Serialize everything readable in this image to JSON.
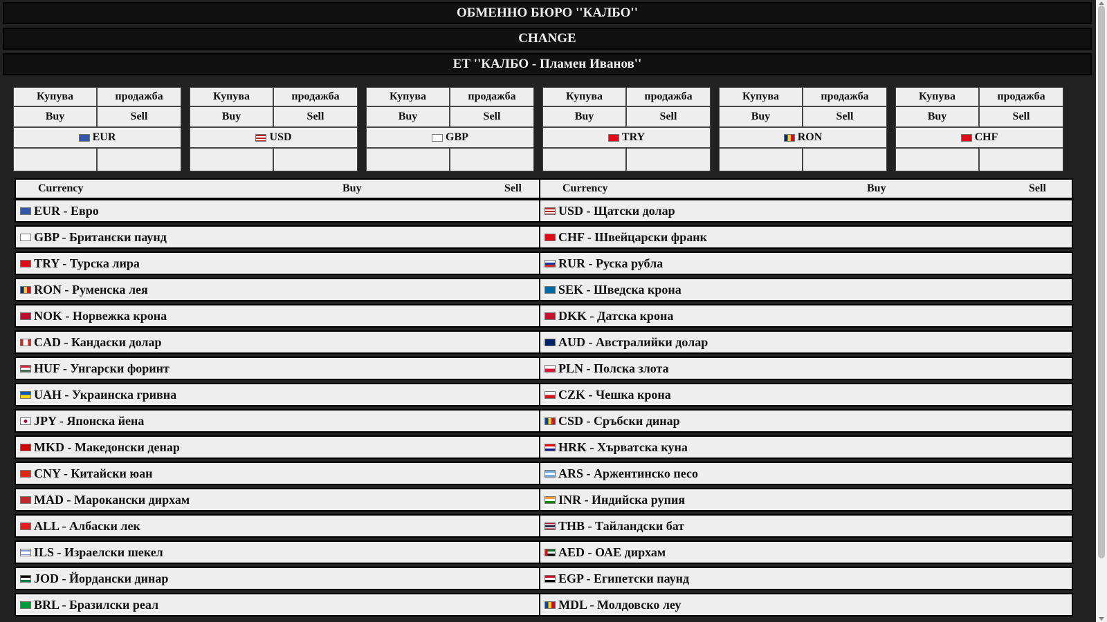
{
  "header": {
    "title": "ОБМЕННО БЮРО ''КАЛБО''",
    "subtitle": "CHANGE",
    "owner": "ЕТ ''КАЛБО - Пламен Иванов''"
  },
  "cards": [
    {
      "buy_bg": "Купува",
      "sell_bg": "продажба",
      "buy_en": "Buy",
      "sell_en": "Sell",
      "code": "EUR",
      "flag": "eu-flag-icon",
      "buy": "",
      "sell": ""
    },
    {
      "buy_bg": "Купува",
      "sell_bg": "продажба",
      "buy_en": "Buy",
      "sell_en": "Sell",
      "code": "USD",
      "flag": "us-flag-icon",
      "buy": "",
      "sell": ""
    },
    {
      "buy_bg": "Купува",
      "sell_bg": "продажба",
      "buy_en": "Buy",
      "sell_en": "Sell",
      "code": "GBP",
      "flag": "gb-flag-icon",
      "buy": "",
      "sell": ""
    },
    {
      "buy_bg": "Купува",
      "sell_bg": "продажба",
      "buy_en": "Buy",
      "sell_en": "Sell",
      "code": "TRY",
      "flag": "tr-flag-icon",
      "buy": "",
      "sell": ""
    },
    {
      "buy_bg": "Купува",
      "sell_bg": "продажба",
      "buy_en": "Buy",
      "sell_en": "Sell",
      "code": "RON",
      "flag": "ro-flag-icon",
      "buy": "",
      "sell": ""
    },
    {
      "buy_bg": "Купува",
      "sell_bg": "продажба",
      "buy_en": "Buy",
      "sell_en": "Sell",
      "code": "CHF",
      "flag": "ch-flag-icon",
      "buy": "",
      "sell": ""
    }
  ],
  "table_headers": {
    "currency": "Currency",
    "buy": "Buy",
    "sell": "Sell"
  },
  "left_rates": [
    {
      "label": "EUR - Евро",
      "flag": "eu-flag-icon"
    },
    {
      "label": "GBP - Британски паунд",
      "flag": "gb-flag-icon"
    },
    {
      "label": "TRY - Турска лира",
      "flag": "tr-flag-icon"
    },
    {
      "label": "RON - Руменска лея",
      "flag": "ro-flag-icon"
    },
    {
      "label": "NOK - Норвежка крона",
      "flag": "no-flag-icon"
    },
    {
      "label": "CAD - Кандаски долар",
      "flag": "ca-flag-icon"
    },
    {
      "label": "HUF - Унгарски форинт",
      "flag": "hu-flag-icon"
    },
    {
      "label": "UAH - Украинска гривна",
      "flag": "ua-flag-icon"
    },
    {
      "label": "JPY - Японска йена",
      "flag": "jp-flag-icon"
    },
    {
      "label": "MKD - Македонски денар",
      "flag": "mk-flag-icon"
    },
    {
      "label": "CNY - Китайски юан",
      "flag": "cn-flag-icon"
    },
    {
      "label": "MAD - Марокански дирхам",
      "flag": "ma-flag-icon"
    },
    {
      "label": "ALL - Албаски лек",
      "flag": "al-flag-icon"
    },
    {
      "label": "ILS - Израелски шекел",
      "flag": "il-flag-icon"
    },
    {
      "label": "JOD - Йордански динар",
      "flag": "jo-flag-icon"
    },
    {
      "label": "BRL - Бразилски реал",
      "flag": "br-flag-icon"
    }
  ],
  "right_rates": [
    {
      "label": "USD - Щатски долар",
      "flag": "us-flag-icon"
    },
    {
      "label": "CHF - Швейцарски франк",
      "flag": "ch-flag-icon"
    },
    {
      "label": "RUR - Руска рубла",
      "flag": "ru-flag-icon"
    },
    {
      "label": "SEK - Шведска крона",
      "flag": "se-flag-icon"
    },
    {
      "label": "DKK - Датска крона",
      "flag": "dk-flag-icon"
    },
    {
      "label": "AUD - Австралийки долар",
      "flag": "au-flag-icon"
    },
    {
      "label": "PLN - Полска злота",
      "flag": "pl-flag-icon"
    },
    {
      "label": "CZK - Чешка крона",
      "flag": "cz-flag-icon"
    },
    {
      "label": "CSD - Сръбски динар",
      "flag": "rs-flag-icon"
    },
    {
      "label": "HRK - Хърватска куна",
      "flag": "hr-flag-icon"
    },
    {
      "label": "ARS - Аржентинско песо",
      "flag": "ar-flag-icon"
    },
    {
      "label": "INR - Индийска рупия",
      "flag": "in-flag-icon"
    },
    {
      "label": "THB - Тайландски бат",
      "flag": "th-flag-icon"
    },
    {
      "label": "AED - ОАЕ дирхам",
      "flag": "ae-flag-icon"
    },
    {
      "label": "EGP - Египетски паунд",
      "flag": "eg-flag-icon"
    },
    {
      "label": "MDL - Молдовско леу",
      "flag": "md-flag-icon"
    }
  ],
  "flag_colors": {
    "eu-flag-icon": "linear-gradient(#3355aa,#3355aa)",
    "us-flag-icon": "repeating-linear-gradient(#b22 0 2px,#fff 2px 4px)",
    "gb-flag-icon": "linear-gradient(#fff,#fff)",
    "tr-flag-icon": "linear-gradient(#e30a17,#e30a17)",
    "ro-flag-icon": "linear-gradient(90deg,#002b7f 33%,#fcd116 33% 66%,#ce1126 66%)",
    "ch-flag-icon": "linear-gradient(#e30a17,#e30a17)",
    "no-flag-icon": "linear-gradient(#ba0c2f,#ba0c2f)",
    "ca-flag-icon": "linear-gradient(90deg,#d52b1e 25%,#fff 25% 75%,#d52b1e 75%)",
    "hu-flag-icon": "linear-gradient(#ce2939 33%,#fff 33% 66%,#477050 66%)",
    "ua-flag-icon": "linear-gradient(#0057b7 50%,#ffd700 50%)",
    "jp-flag-icon": "radial-gradient(circle,#bc002d 28%,#fff 30%)",
    "mk-flag-icon": "linear-gradient(#d20000,#d20000)",
    "cn-flag-icon": "linear-gradient(#de2910,#de2910)",
    "ma-flag-icon": "linear-gradient(#c1272d,#c1272d)",
    "al-flag-icon": "linear-gradient(#e41e20,#e41e20)",
    "il-flag-icon": "linear-gradient(#fff 15%,#0038b8 15% 25%,#fff 25% 75%,#0038b8 75% 85%,#fff 85%)",
    "jo-flag-icon": "linear-gradient(#000 33%,#fff 33% 66%,#007a3d 66%)",
    "br-flag-icon": "linear-gradient(#009c3b,#009c3b)",
    "ru-flag-icon": "linear-gradient(#fff 33%,#0039a6 33% 66%,#d52b1e 66%)",
    "se-flag-icon": "linear-gradient(#006aa7,#006aa7)",
    "dk-flag-icon": "linear-gradient(#c8102e,#c8102e)",
    "au-flag-icon": "linear-gradient(#012169,#012169)",
    "pl-flag-icon": "linear-gradient(#fff 50%,#dc143c 50%)",
    "cz-flag-icon": "linear-gradient(#fff 50%,#d7141a 50%)",
    "rs-flag-icon": "linear-gradient(90deg,#0046ae 33%,#ffd200 33% 66%,#d21034 66%)",
    "hr-flag-icon": "linear-gradient(#ff0000 33%,#fff 33% 66%,#171796 66%)",
    "ar-flag-icon": "linear-gradient(#74acdf 33%,#fff 33% 66%,#74acdf 66%)",
    "in-flag-icon": "linear-gradient(#ff9933 33%,#fff 33% 66%,#138808 66%)",
    "th-flag-icon": "linear-gradient(#a51931 16%,#fff 16% 33%,#2d2a4a 33% 66%,#fff 66% 83%,#a51931 83%)",
    "ae-flag-icon": "linear-gradient(90deg,#ff0000 25%,transparent 25%),linear-gradient(#00732f 33%,#fff 33% 66%,#000 66%)",
    "eg-flag-icon": "linear-gradient(#ce1126 33%,#fff 33% 66%,#000 66%)",
    "md-flag-icon": "linear-gradient(90deg,#0046ae 33%,#ffd200 33% 66%,#cc092f 66%)"
  }
}
